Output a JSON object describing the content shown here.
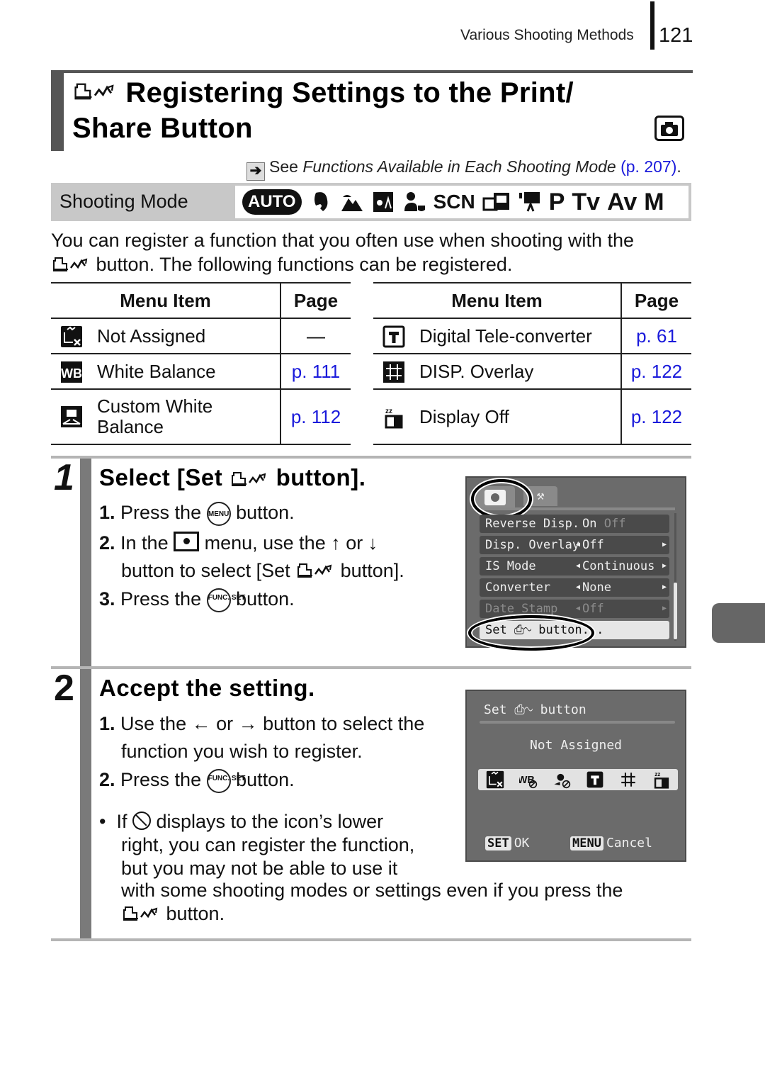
{
  "header": {
    "section": "Various Shooting Methods",
    "page_number": "121"
  },
  "title": {
    "icon": "print-share-icon",
    "text": "Registering Settings to the Print/ Share Button",
    "mode_badge_icon": "camera-icon"
  },
  "see_also": {
    "prefix": "See ",
    "italic": "Functions Available in Each Shooting Mode",
    "link": "(p. 207)",
    "suffix": "."
  },
  "shooting_mode": {
    "label": "Shooting Mode",
    "modes": [
      "AUTO",
      "portrait",
      "landscape",
      "night-snapshot",
      "kids-and-pets",
      "SCN",
      "stitch-assist",
      "movie",
      "P",
      "Tv",
      "Av",
      "M"
    ],
    "scn_label": "SCN",
    "auto_label": "AUTO",
    "p_label": "P",
    "tv_label": "Tv",
    "av_label": "Av",
    "m_label": "M"
  },
  "intro": {
    "line1": "You can register a function that you often use when shooting with the",
    "line2": " button. The following functions can be registered."
  },
  "tables": {
    "header_item": "Menu Item",
    "header_page": "Page",
    "left": [
      {
        "icon": "not-assigned-icon",
        "label": "Not Assigned",
        "page": "—"
      },
      {
        "icon": "white-balance-icon",
        "label": "White Balance",
        "page": "p. 111"
      },
      {
        "icon": "custom-white-balance-icon",
        "label_line1": "Custom White",
        "label_line2": "Balance",
        "page": "p. 112"
      }
    ],
    "right": [
      {
        "icon": "digital-tele-converter-icon",
        "label": "Digital Tele-converter",
        "page": "p. 61"
      },
      {
        "icon": "disp-overlay-icon",
        "label": "DISP. Overlay",
        "page": "p. 122"
      },
      {
        "icon": "display-off-icon",
        "label": "Display Off",
        "page": "p. 122"
      }
    ]
  },
  "step1": {
    "number": "1",
    "title_a": "Select [Set ",
    "title_b": " button].",
    "items": [
      {
        "num": "1.",
        "a": " Press the ",
        "btn": "MENU",
        "b": " button."
      },
      {
        "num": "2.",
        "a": " In the ",
        "b": " menu, use the ",
        "up": "↑",
        "or": " or ",
        "down": "↓"
      },
      {
        "cont_a": "button to select [Set ",
        "cont_b": " button]."
      },
      {
        "num": "3.",
        "a": " Press the ",
        "btn": "FUNC. SET",
        "b": " button."
      }
    ],
    "screen": {
      "tabs": [
        "shooting",
        "setup"
      ],
      "rows": [
        {
          "key": "Reverse Disp.",
          "value": "On",
          "value2": "Off"
        },
        {
          "key": "Disp. Overlay",
          "value": "Off"
        },
        {
          "key": "IS Mode",
          "value": "Continuous"
        },
        {
          "key": "Converter",
          "value": "None"
        },
        {
          "key": "Date Stamp",
          "value": "Off"
        },
        {
          "key": "Set ⎙∿ button..."
        }
      ]
    }
  },
  "step2": {
    "number": "2",
    "title": "Accept the setting.",
    "items": [
      {
        "num": "1.",
        "a": " Use the ",
        "left": "←",
        "or": " or ",
        "right": "→",
        "b": " button to select the"
      },
      {
        "cont": "function you wish to register."
      },
      {
        "num": "2.",
        "a": " Press the ",
        "btn": "FUNC. SET",
        "b": " button."
      }
    ],
    "note": {
      "bullet": "•",
      "line1_a": "If ",
      "line1_b": " displays to the icon’s lower",
      "line2": "right, you can register the function,",
      "line3": "but you may not be able to use it",
      "line4": "with some shooting modes or settings even if you press the",
      "line5": " button."
    },
    "screen": {
      "title": "Set ⎙∿ button",
      "current": "Not Assigned",
      "icons": [
        "not-assigned-icon",
        "white-balance-icon",
        "custom-white-balance-icon",
        "digital-tele-converter-icon",
        "disp-overlay-icon",
        "display-off-icon"
      ],
      "ok_key": "SET",
      "ok_label": "OK",
      "cancel_key": "MENU",
      "cancel_label": "Cancel"
    }
  }
}
